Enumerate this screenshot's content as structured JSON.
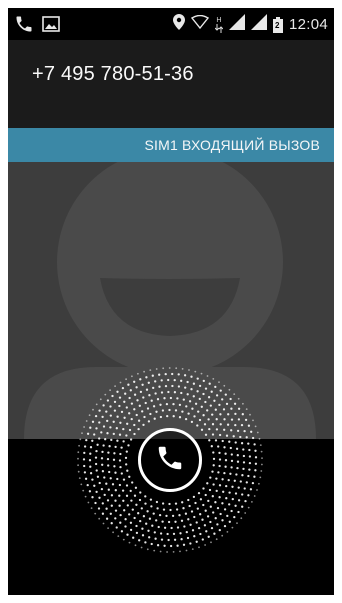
{
  "status_bar": {
    "time": "12:04",
    "network_badge": "H",
    "sim_badge": "2",
    "icons": {
      "left": [
        "phone-icon",
        "image-icon"
      ],
      "right": [
        "location-pin-icon",
        "wifi-icon",
        "data-arrows-icon",
        "signal-sim1-icon",
        "signal-sim2-icon",
        "battery-icon"
      ]
    }
  },
  "caller": {
    "number": "+7 495 780-51-36"
  },
  "sim_banner": {
    "label": "SIM1 ВХОДЯЩИЙ ВЫЗОВ"
  },
  "controls": {
    "answer_icon": "phone-icon"
  },
  "colors": {
    "banner": "#3b88a6",
    "photo_bg": "#3d3d3d",
    "silhouette": "#4a4a4a"
  }
}
